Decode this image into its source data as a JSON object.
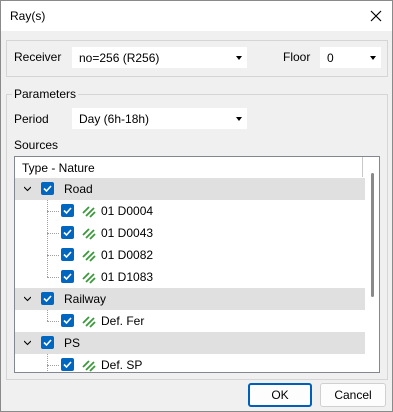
{
  "window": {
    "title": "Ray(s)"
  },
  "receiver": {
    "label": "Receiver",
    "value": "no=256 (R256)"
  },
  "floor": {
    "label": "Floor",
    "value": "0"
  },
  "parameters": {
    "title": "Parameters",
    "period_label": "Period",
    "period_value": "Day (6h-18h)"
  },
  "sources": {
    "label": "Sources",
    "column_header": "Type - Nature",
    "groups": [
      {
        "label": "Road",
        "children": [
          "01 D0004",
          "01 D0043",
          "01 D0082",
          "01 D1083"
        ]
      },
      {
        "label": "Railway",
        "children": [
          "Def. Fer"
        ]
      },
      {
        "label": "PS",
        "children": [
          "Def. SP"
        ]
      }
    ]
  },
  "buttons": {
    "ok": "OK",
    "cancel": "Cancel"
  },
  "colors": {
    "accent": "#0067c0",
    "source_icon": "#3a9a3a",
    "group_row": "#e0e0e0"
  }
}
